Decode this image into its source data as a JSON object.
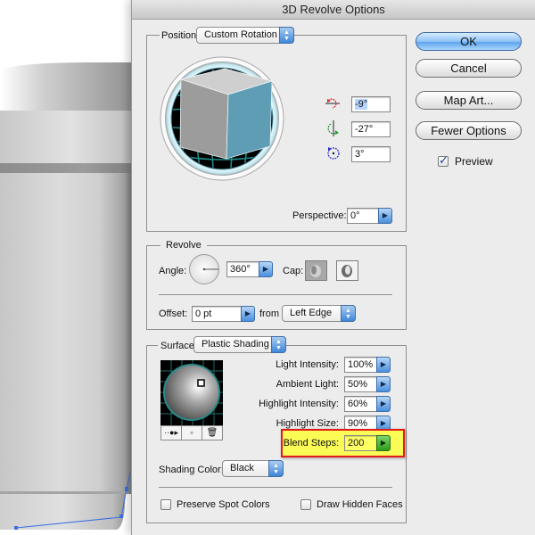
{
  "dialog": {
    "title": "3D Revolve Options",
    "buttons": {
      "ok": "OK",
      "cancel": "Cancel",
      "map_art": "Map Art...",
      "fewer_options": "Fewer Options"
    },
    "preview": {
      "label": "Preview",
      "checked": true
    }
  },
  "position": {
    "label": "Position:",
    "preset": "Custom Rotation",
    "rotation_x": "-9°",
    "rotation_y": "-27°",
    "rotation_z": "3°",
    "axis_icons": [
      "rotate-x-icon",
      "rotate-y-icon",
      "rotate-z-icon"
    ],
    "perspective_label": "Perspective:",
    "perspective_value": "0°"
  },
  "revolve": {
    "legend": "Revolve",
    "angle_label": "Angle:",
    "angle_value": "360°",
    "cap_label": "Cap:",
    "cap_on_selected": true,
    "offset_label": "Offset:",
    "offset_value": "0 pt",
    "from_label": "from",
    "from_value": "Left Edge"
  },
  "surface": {
    "label": "Surface:",
    "value": "Plastic Shading",
    "light_intensity_label": "Light Intensity:",
    "light_intensity": "100%",
    "ambient_light_label": "Ambient Light:",
    "ambient_light": "50%",
    "highlight_intensity_label": "Highlight Intensity:",
    "highlight_intensity": "60%",
    "highlight_size_label": "Highlight Size:",
    "highlight_size": "90%",
    "blend_steps_label": "Blend Steps:",
    "blend_steps": "200",
    "shading_color_label": "Shading Color:",
    "shading_color": "Black",
    "preserve_spot_colors": {
      "label": "Preserve Spot Colors",
      "checked": false
    },
    "draw_hidden_faces": {
      "label": "Draw Hidden Faces",
      "checked": false
    }
  },
  "colors": {
    "cube_front": "#5f9db5",
    "cube_side": "#9c9c9c",
    "cube_top": "#cfcfcf",
    "grid": "#1e8a8a",
    "highlight_box": "#fbfb55",
    "highlight_border": "#e21a1a",
    "path_selection": "#3a6fe0"
  }
}
